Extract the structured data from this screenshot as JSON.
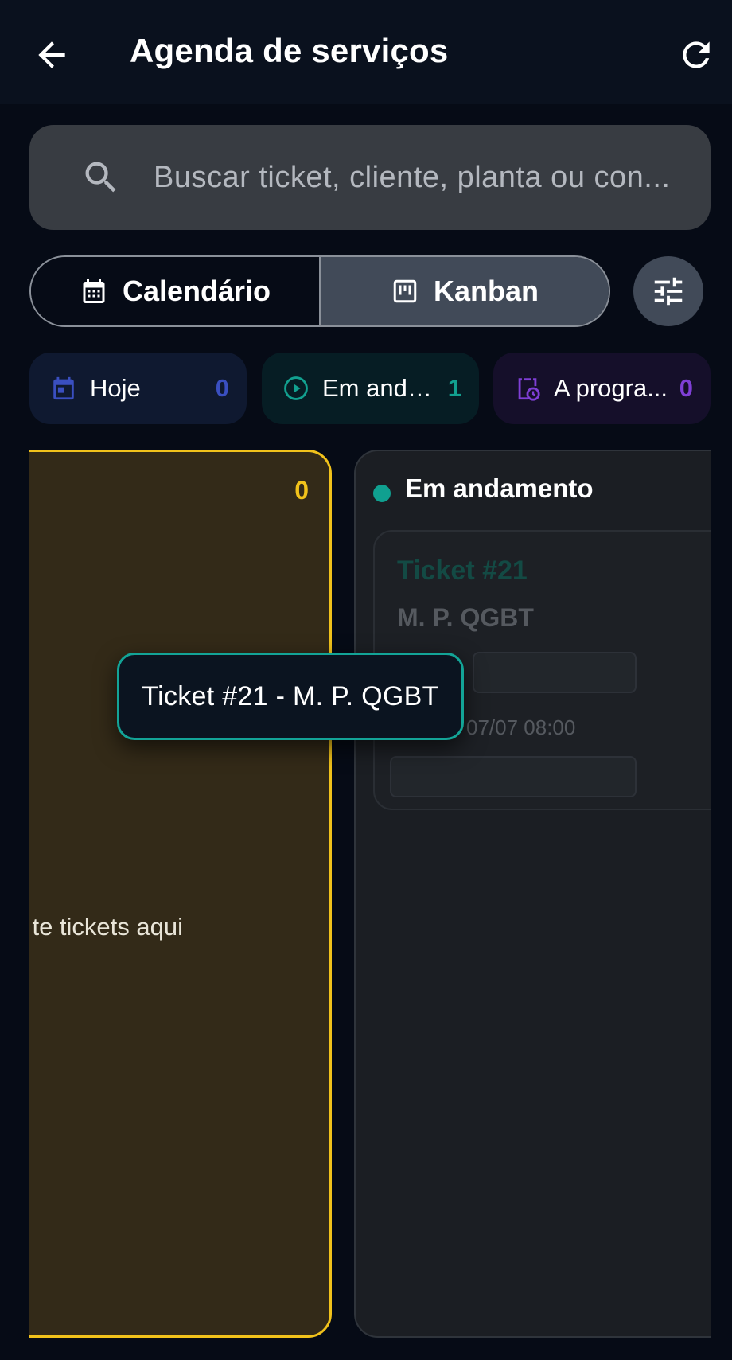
{
  "appbar": {
    "title": "Agenda de serviços"
  },
  "search": {
    "placeholder": "Buscar ticket, cliente, planta ou con..."
  },
  "view_toggle": {
    "calendar_label": "Calendário",
    "kanban_label": "Kanban",
    "selected": "Kanban"
  },
  "chips": {
    "today": {
      "label": "Hoje",
      "count": "0",
      "color": "#3a4fc0"
    },
    "in_progress": {
      "label": "Em anda...",
      "count": "1",
      "color": "#12a08f"
    },
    "to_schedule": {
      "label": "A progra...",
      "count": "0",
      "color": "#7f3fd6"
    }
  },
  "board": {
    "left_column": {
      "count": "0",
      "hint": "te tickets aqui",
      "accent": "#f1c21b"
    },
    "in_progress_column": {
      "title": "Em andamento",
      "dot_color": "#10a090",
      "card": {
        "title": "Ticket #21",
        "subtitle": "M. P. QGBT",
        "date": "07/07 08:00"
      }
    }
  },
  "drag_preview": {
    "text": "Ticket #21 - M. P. QGBT"
  }
}
